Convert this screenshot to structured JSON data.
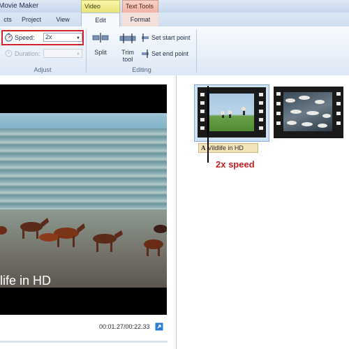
{
  "window": {
    "title": "Movie Maker",
    "context_tabs": {
      "video_tools": "Video Tools",
      "text_tools": "Text Tools"
    }
  },
  "tabs": {
    "visuals": "cts",
    "project": "Project",
    "view": "View",
    "edit": "Edit",
    "format": "Format"
  },
  "ribbon": {
    "adjust": {
      "label": "Adjust",
      "speed": {
        "label": "Speed:",
        "value": "2x"
      },
      "duration": {
        "label": "Duration:",
        "value": ""
      }
    },
    "editing": {
      "label": "Editing",
      "split": "Split",
      "trim_line1": "Trim",
      "trim_line2": "tool",
      "set_start": "Set start point",
      "set_end": "Set end point"
    }
  },
  "preview": {
    "overlay_text": "life in HD",
    "time": "00:01.27/00:22.33"
  },
  "storyboard": {
    "clip1_caption": "Vildlife in HD",
    "speed_note": "2x speed"
  },
  "colors": {
    "highlight": "#d2232a",
    "note": "#c81e1e"
  }
}
